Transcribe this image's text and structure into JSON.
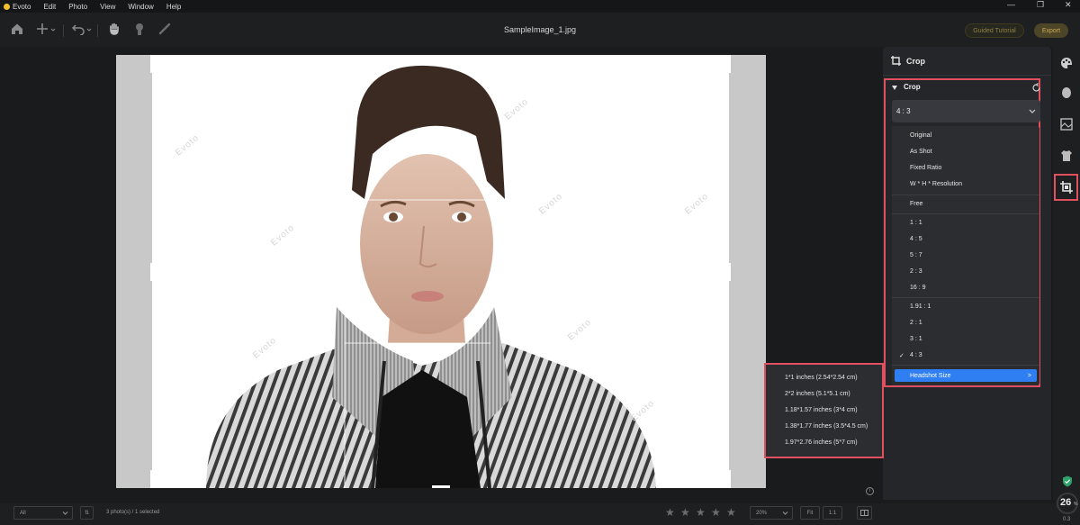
{
  "app": {
    "name": "Evoto",
    "file_title": "SampleImage_1.jpg"
  },
  "menubar": {
    "items": [
      "Evoto",
      "Edit",
      "Photo",
      "View",
      "Window",
      "Help"
    ],
    "window_controls": [
      "—",
      "❐",
      "✕"
    ]
  },
  "toolbar": {
    "icons": [
      "home-icon",
      "add-icon",
      "undo-icon",
      "hand-icon",
      "portrait-icon",
      "brush-icon"
    ],
    "guided_tutorial_label": "Guided Tutorial",
    "export_label": "Export",
    "export_color": "#e3c35a"
  },
  "canvas": {
    "watermark_text": "Evoto"
  },
  "panel": {
    "header_title": "Crop",
    "section_title": "Crop",
    "selected_ratio": "4 : 3",
    "options_group1": [
      "Original",
      "As Shot",
      "Fixed Ratio",
      "W * H * Resolution"
    ],
    "options_group2": [
      "Free"
    ],
    "options_group3": [
      "1 : 1",
      "4 : 5",
      "5 : 7",
      "2 : 3",
      "16 : 9"
    ],
    "options_group4": [
      "1.91 : 1",
      "2 : 1",
      "3 : 1",
      "4 : 3"
    ],
    "checked_option": "4 : 3",
    "checkmark": "✓",
    "headshot_label": "Headshot Size",
    "headshot_chevron": ">",
    "highlight_color": "#e0505f",
    "accent_color": "#2f7ef2"
  },
  "submenu": {
    "items": [
      "1*1 inches (2.54*2.54 cm)",
      "2*2 inches (5.1*5.1 cm)",
      "1.18*1.57 inches (3*4 cm)",
      "1.38*1.77 inches (3.5*4.5 cm)",
      "1.97*2.76 inches (5*7 cm)"
    ]
  },
  "sidebar": {
    "icons": [
      "palette-icon",
      "face-icon",
      "background-icon",
      "clothing-icon",
      "crop-icon"
    ]
  },
  "statusbar": {
    "filter_value": "All",
    "sort_label": "⇅",
    "photo_count": "3 photo(s) / 1 selected",
    "stars": [
      "★",
      "★",
      "★",
      "★",
      "★"
    ],
    "zoom_value": "20%",
    "fit_label": "Fit",
    "one_to_one_label": "1:1",
    "info_icon_label": "i",
    "badge_value": "26",
    "badge_unit": "%",
    "badge_sub": "0.3"
  }
}
